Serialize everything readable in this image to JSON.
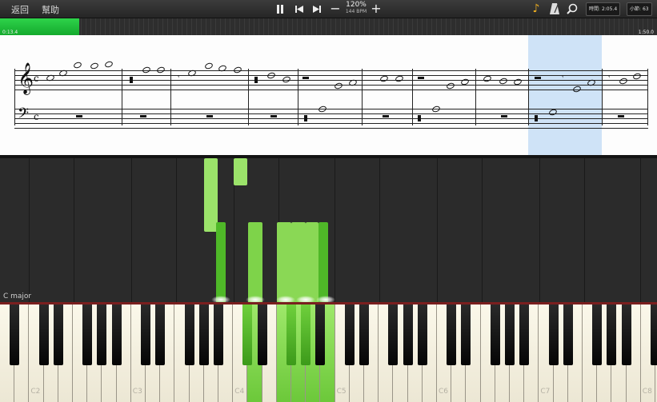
{
  "toolbar": {
    "back_label": "返回",
    "help_label": "幫助",
    "tempo_percent": "120%",
    "tempo_bpm": "144 BPM",
    "time_label": "時間",
    "time_value": "2:05.4",
    "measure_label": "小節",
    "measure_value": "63",
    "icons": [
      "pause-icon",
      "skip-back-icon",
      "skip-forward-icon",
      "minus-icon",
      "plus-icon",
      "note-icon",
      "metronome-icon",
      "zoom-icon"
    ]
  },
  "progress": {
    "elapsed": "0:13.4",
    "total": "1:50.0",
    "fraction": 0.12
  },
  "roll": {
    "key_signature": "C major"
  },
  "keyboard": {
    "c_labels": [
      "C2",
      "C3",
      "C4",
      "C5",
      "C6",
      "C7",
      "C8"
    ]
  },
  "colors": {
    "note_green": "#7ed34a",
    "progress_green": "#1fc13b",
    "measure_highlight": "#cfe3f7"
  }
}
